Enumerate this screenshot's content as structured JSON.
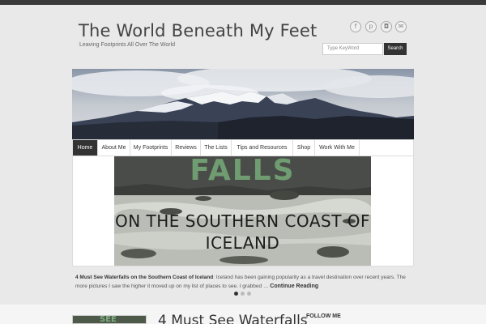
{
  "site": {
    "title": "The World Beneath My Feet",
    "tagline": "Leaving Footprints All Over The World"
  },
  "social": [
    {
      "icon": "facebook-icon",
      "glyph": "f"
    },
    {
      "icon": "pinterest-icon",
      "glyph": "p"
    },
    {
      "icon": "instagram-icon",
      "glyph": "◘"
    },
    {
      "icon": "email-icon",
      "glyph": "✉"
    }
  ],
  "search": {
    "placeholder": "Type KeyWord",
    "button_label": "Search"
  },
  "nav": {
    "items": [
      "Home",
      "About Me",
      "My Footprints",
      "Reviews",
      "The Lists",
      "Tips and Resources",
      "Shop",
      "Work With Me"
    ],
    "active_index": 0
  },
  "slider": {
    "image_title_top": "FALLS",
    "image_title_line1": "ON THE SOUTHERN COAST OF",
    "image_title_line2": "ICELAND",
    "excerpt_title": "4 Must See Waterfalls on the Southern Coast of Iceland",
    "excerpt_text": ": Iceland has been gaining popularity as a travel destination over recent years. The more pictures I saw the higher it moved up on my list of places to see. I grabbed … ",
    "continue_label": "Continue Reading",
    "dots": 3,
    "active_dot": 0
  },
  "post": {
    "thumb_text": "SEE",
    "title": "4 Must See Waterfalls"
  },
  "sidebar": {
    "follow_label": "FOLLOW ME"
  },
  "colors": {
    "topbar": "#3a3a3a",
    "nav_active": "#333333",
    "falls_green": "#6f9c70"
  }
}
